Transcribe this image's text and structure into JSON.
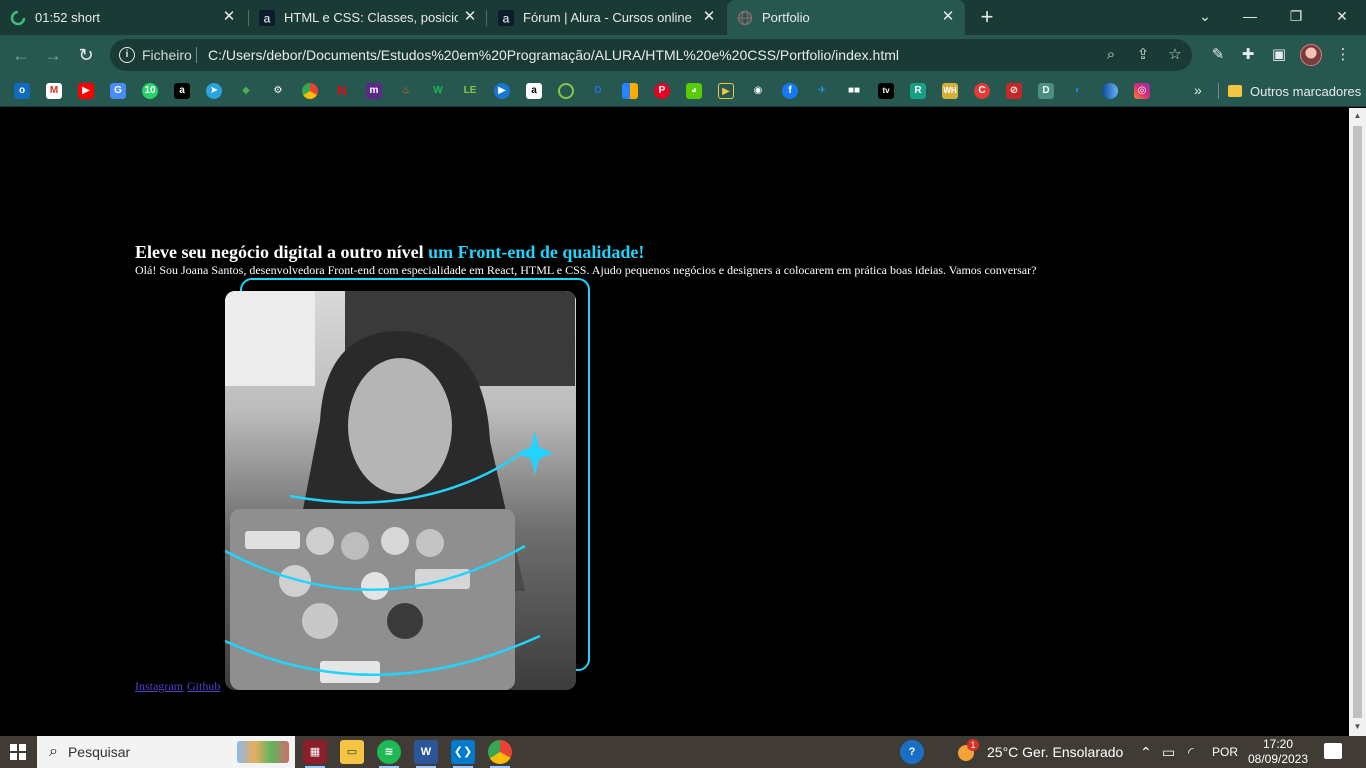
{
  "browser": {
    "tabs": [
      {
        "title": "01:52 short",
        "active": false
      },
      {
        "title": "HTML e CSS: Classes, posicionam",
        "active": false
      },
      {
        "title": "Fórum | Alura - Cursos online de",
        "active": false
      },
      {
        "title": "Portfolio",
        "active": true
      }
    ],
    "address": {
      "scheme_label": "Ficheiro",
      "url": "C:/Users/debor/Documents/Estudos%20em%20Programação/ALURA/HTML%20e%20CSS/Portfolio/index.html"
    },
    "bookmarks_folder": "Outros marcadores"
  },
  "page": {
    "headline": "Eleve seu negócio digital a outro nível ",
    "headline_accent": "um Front-end de qualidade!",
    "intro": "Olá! Sou Joana Santos, desenvolvedora Front-end com especialidade em React, HTML e CSS. Ajudo pequenos negócios e designers a colocarem em prática boas ideias. Vamos conversar?",
    "links": [
      {
        "label": "Instagram"
      },
      {
        "label": "Github"
      }
    ],
    "accent_color": "#22d4fd"
  },
  "taskbar": {
    "search_placeholder": "Pesquisar",
    "weather": "25°C  Ger. Ensolarado",
    "language": "POR",
    "time": "17:20",
    "date": "08/09/2023",
    "weather_badge": "1"
  }
}
